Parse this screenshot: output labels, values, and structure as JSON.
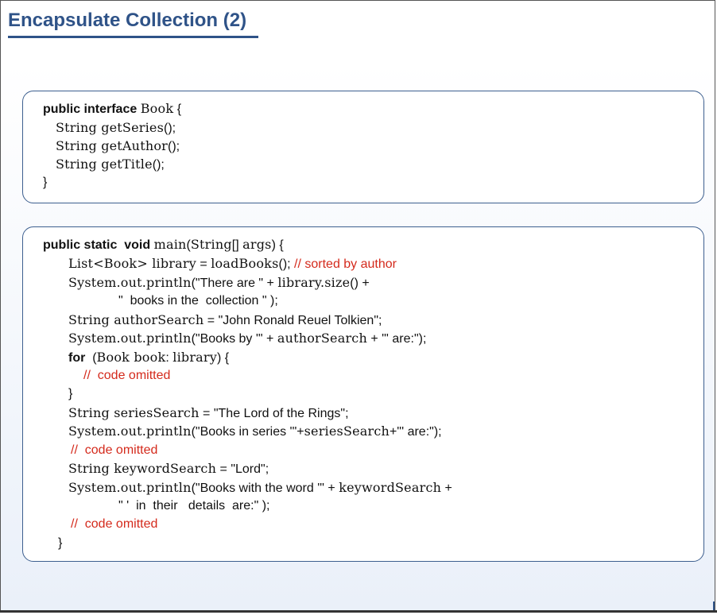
{
  "slide": {
    "title": "Encapsulate Collection (2)"
  },
  "box1": {
    "l1": {
      "kw": "public interface",
      "t1": "Book",
      "t2": "{"
    },
    "l2": {
      "t1": "String getSeries",
      "t2": "();"
    },
    "l3": {
      "t1": "String getAuthor",
      "t2": "();"
    },
    "l4": {
      "t1": "String getTitle",
      "t2": "();"
    },
    "l5": {
      "t1": "}"
    }
  },
  "box2": {
    "l1": {
      "kw": "public static  void",
      "t1": "main",
      "t2": "(",
      "t3": "String",
      "t4": "[] ",
      "t5": "args",
      "t6": ") {"
    },
    "l2": {
      "t1": "List",
      "t2": "<",
      "t3": "Book",
      "t4": ">",
      "t5": " library",
      "t6": " = ",
      "t7": "loadBooks",
      "t8": "(); ",
      "c1": "// sorted by author"
    },
    "l3": {
      "t1": "System.out.println",
      "t2": "(\"There are \" + ",
      "t3": "library.size",
      "t4": "() +"
    },
    "l4": {
      "t1": "\"  books in the  collection \" );"
    },
    "l5": {
      "t1": "String authorSearch",
      "t2": " = \"John Ronald Reuel Tolkien\";"
    },
    "l6": {
      "t1": "System.out.println",
      "t2": "(\"Books by '\" + ",
      "t3": "authorSearch",
      "t4": " + \"' are:\");"
    },
    "l7": {
      "kw": "for",
      "t1": "  (",
      "t2": "Book book",
      "t3": ": ",
      "t4": "library",
      "t5": ") {"
    },
    "l8": {
      "c1": "//  code omitted"
    },
    "l9": {
      "t1": "}"
    },
    "l10": {
      "t1": "String seriesSearch",
      "t2": " = \"The Lord of the Rings\";"
    },
    "l11": {
      "t1": "System.out.println",
      "t2": "(\"Books in series '\"+",
      "t3": "seriesSearch",
      "t4": "+\"' are:\");"
    },
    "l12": {
      "c1": "//  code omitted"
    },
    "l13": {
      "t1": "String keywordSearch",
      "t2": " = \"Lord\";"
    },
    "l14": {
      "t1": "System.out.println",
      "t2": "(\"Books with the word '\" + ",
      "t3": "keywordSearch",
      "t4": " +"
    },
    "l15": {
      "t1": "\" '  in  their   details  are:\" );"
    },
    "l16": {
      "c1": "//  code omitted"
    },
    "l17": {
      "t1": "}"
    }
  }
}
